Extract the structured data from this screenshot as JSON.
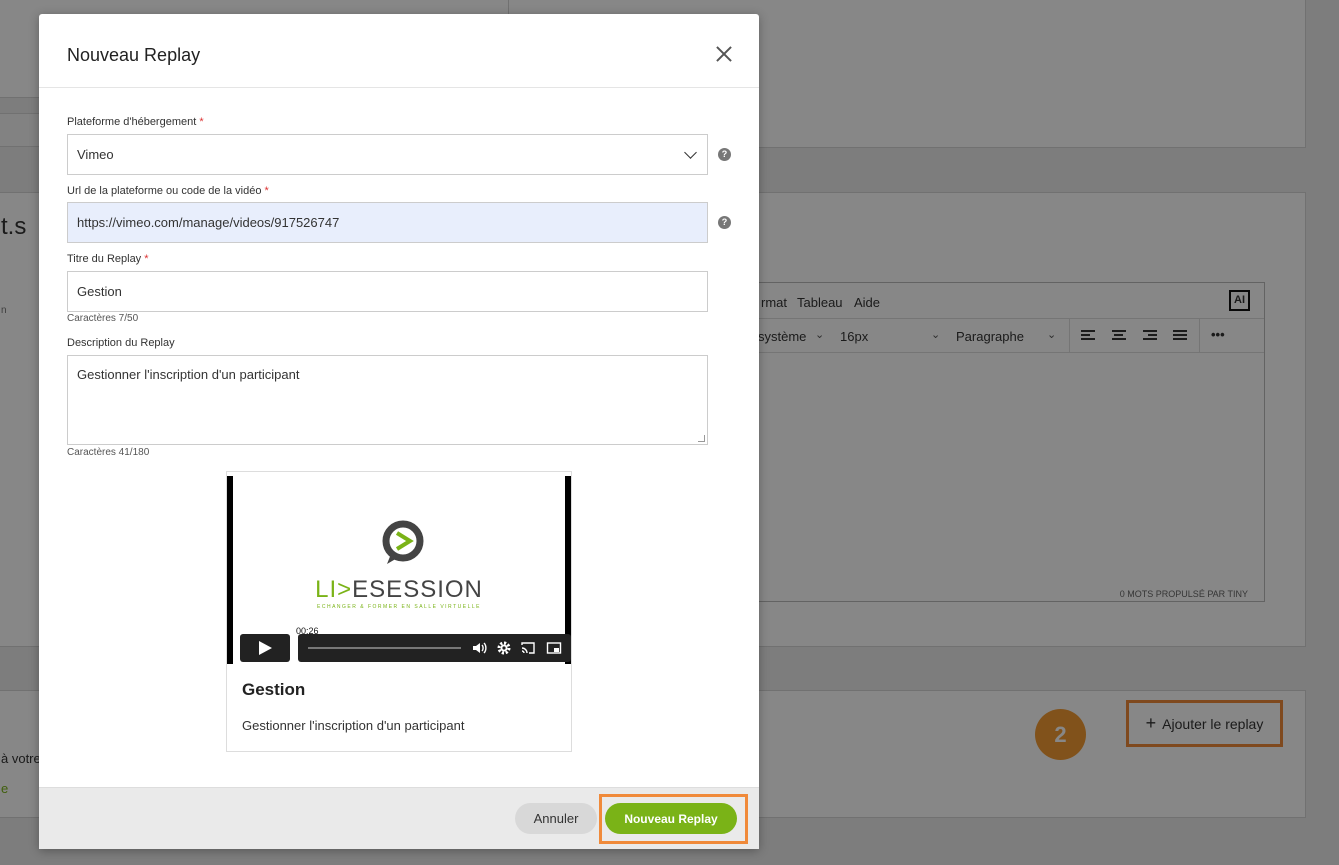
{
  "background": {
    "partial_texts": {
      "left_heading": "t.s",
      "left_small": "n",
      "left_bottom": "à votre",
      "left_link": "e"
    },
    "editor": {
      "menu": [
        "rmat",
        "Tableau",
        "Aide"
      ],
      "ai_label": "AI",
      "font_family": "système",
      "font_size": "16px",
      "block_format": "Paragraphe",
      "more_label": "•••",
      "status": "0 MOTS  PROPULSÉ PAR TINY"
    },
    "add_replay_label": "Ajouter le replay",
    "add_replay_icon": "plus-icon",
    "step_number": "2",
    "colors": {
      "highlight": "#f08a3a",
      "badge": "#f39c34"
    }
  },
  "modal": {
    "title": "Nouveau Replay",
    "close_icon": "close-icon",
    "fields": {
      "platform": {
        "label": "Plateforme d'hébergement",
        "required_mark": "*",
        "value": "Vimeo"
      },
      "url": {
        "label": "Url de la plateforme ou code de la vidéo",
        "required_mark": "*",
        "value": "https://vimeo.com/manage/videos/917526747"
      },
      "title": {
        "label": "Titre du Replay",
        "required_mark": "*",
        "value": "Gestion",
        "counter": "Caractères 7/50"
      },
      "description": {
        "label": "Description du Replay",
        "value": "Gestionner l'inscription d'un participant",
        "counter": "Caractères 41/180"
      }
    },
    "help_mark": "?",
    "preview": {
      "logo_text_green": "LI",
      "logo_text_mark": ">",
      "logo_text_dark": "E",
      "logo_text_rest": "SESSION",
      "logo_tagline": "ECHANGER & FORMER EN SALLE VIRTUELLE",
      "timecode": "00:26",
      "title": "Gestion",
      "description": "Gestionner l'inscription d'un participant"
    },
    "footer": {
      "cancel_label": "Annuler",
      "submit_label": "Nouveau Replay"
    },
    "colors": {
      "primary": "#7ab317",
      "url_field_bg": "#e8eefc"
    }
  }
}
